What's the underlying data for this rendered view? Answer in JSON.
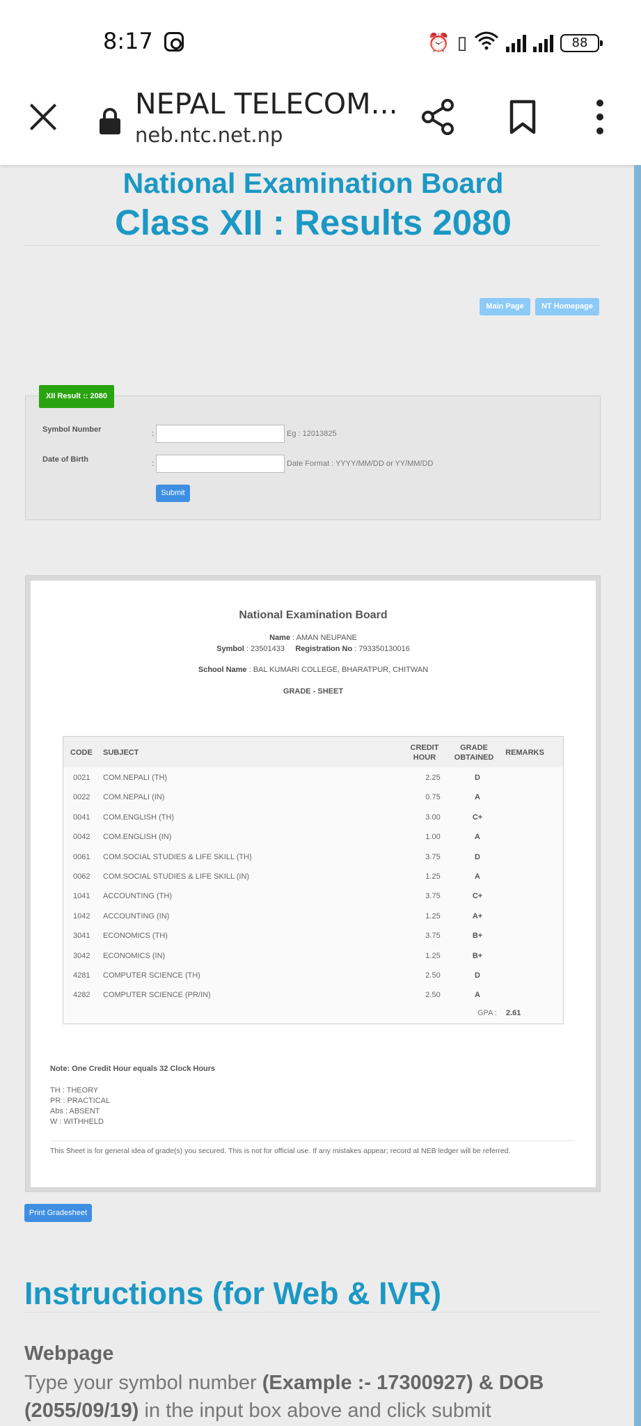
{
  "status_bar": {
    "time": "8:17",
    "battery": "88",
    "icons": [
      "instagram-icon",
      "alarm-icon",
      "vibrate-icon",
      "wifi-icon",
      "signal-icon",
      "signal-icon",
      "battery-icon"
    ]
  },
  "browser": {
    "title": "NEPAL TELECOM...",
    "url": "neb.ntc.net.np"
  },
  "header": {
    "org": "National Examination Board",
    "subtitle": "Class XII : Results 2080",
    "main_page_btn": "Main Page",
    "nt_homepage_btn": "NT Homepage"
  },
  "form": {
    "tab_label": "XII Result :: 2080",
    "symbol_label": "Symbol Number",
    "symbol_value": "",
    "symbol_hint": "Eg : 12013825",
    "dob_label": "Date of Birth",
    "dob_value": "",
    "dob_hint": "Date Format : YYYY/MM/DD or YY/MM/DD",
    "colon": ":",
    "submit": "Submit"
  },
  "sheet": {
    "title": "National Examination Board",
    "name_label": "Name",
    "name": ": AMAN NEUPANE",
    "symbol_label": "Symbol",
    "symbol": ": 23501433",
    "reg_label": "Registration No",
    "reg": ": 793350130016",
    "school_label": "School Name",
    "school": ": BAL KUMARI COLLEGE, BHARATPUR, CHITWAN",
    "grade_sheet": "GRADE - SHEET",
    "columns": {
      "code": "CODE",
      "subject": "SUBJECT",
      "credit_1": "CREDIT",
      "credit_2": "HOUR",
      "grade_1": "GRADE",
      "grade_2": "OBTAINED",
      "remarks": "REMARKS"
    },
    "rows": [
      {
        "code": "0021",
        "subject": "COM.NEPALI (TH)",
        "credit": "2.25",
        "grade": "D"
      },
      {
        "code": "0022",
        "subject": "COM.NEPALI (IN)",
        "credit": "0.75",
        "grade": "A"
      },
      {
        "code": "0041",
        "subject": "COM.ENGLISH (TH)",
        "credit": "3.00",
        "grade": "C+"
      },
      {
        "code": "0042",
        "subject": "COM.ENGLISH (IN)",
        "credit": "1.00",
        "grade": "A"
      },
      {
        "code": "0061",
        "subject": "COM.SOCIAL STUDIES & LIFE SKILL (TH)",
        "credit": "3.75",
        "grade": "D"
      },
      {
        "code": "0062",
        "subject": "COM.SOCIAL STUDIES & LIFE SKILL (IN)",
        "credit": "1.25",
        "grade": "A"
      },
      {
        "code": "1041",
        "subject": "ACCOUNTING (TH)",
        "credit": "3.75",
        "grade": "C+"
      },
      {
        "code": "1042",
        "subject": "ACCOUNTING (IN)",
        "credit": "1.25",
        "grade": "A+"
      },
      {
        "code": "3041",
        "subject": "ECONOMICS (TH)",
        "credit": "3.75",
        "grade": "B+"
      },
      {
        "code": "3042",
        "subject": "ECONOMICS (IN)",
        "credit": "1.25",
        "grade": "B+"
      },
      {
        "code": "4281",
        "subject": "COMPUTER SCIENCE (TH)",
        "credit": "2.50",
        "grade": "D"
      },
      {
        "code": "4282",
        "subject": "COMPUTER SCIENCE (PR/IN)",
        "credit": "2.50",
        "grade": "A"
      }
    ],
    "gpa_label": "GPA :",
    "gpa": "2.61",
    "note_title": "Note: One Credit Hour equals 32 Clock Hours",
    "legend": [
      "TH : THEORY",
      "PR : PRACTICAL",
      "Abs : ABSENT",
      "W : WITHHELD"
    ],
    "disclaimer": "This Sheet is for general idea of grade(s) you secured. This is not for official use. If any mistakes appear; record at NEB ledger will be referred."
  },
  "print_btn": "Print Gradesheet",
  "instructions": {
    "title": "Instructions (for Web & IVR)",
    "web_heading": "Webpage",
    "web_text_1": "Type your symbol number ",
    "web_example": "(Example :- 17300927) & DOB (2055/09/19)",
    "web_text_2": " in the input box above and click submit"
  }
}
